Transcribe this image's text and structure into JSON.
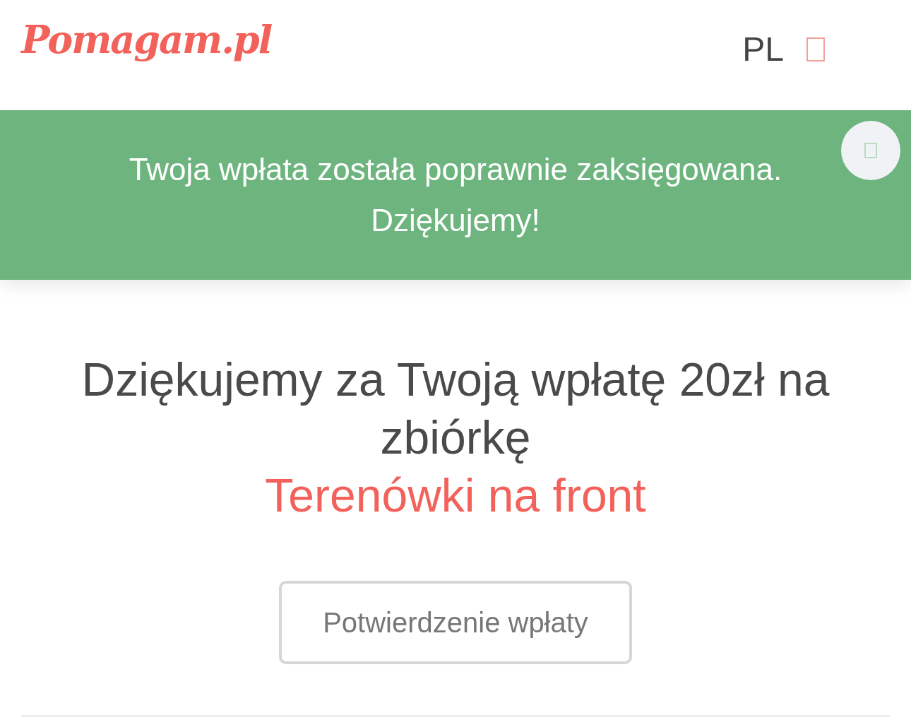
{
  "header": {
    "logo": "Pomagam.pl",
    "language": "PL"
  },
  "alert": {
    "message": "Twoja wpłata została poprawnie zaksięgowana. Dziękujemy!"
  },
  "main": {
    "heading": "Dziękujemy za Twoją wpłatę 20zł na zbiórkę",
    "campaign": "Terenówki na front",
    "button": "Potwierdzenie wpłaty"
  }
}
